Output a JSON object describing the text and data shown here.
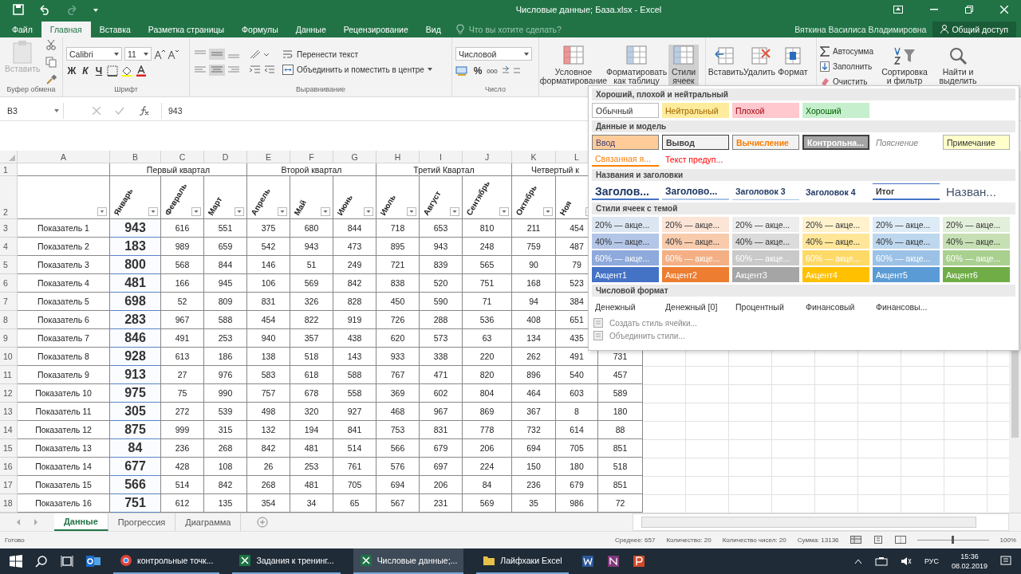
{
  "title_bar": {
    "title": "Числовые данные; База.xlsx - Excel"
  },
  "ribbon_tabs": [
    {
      "label": "Файл",
      "selected": false
    },
    {
      "label": "Главная",
      "selected": true
    },
    {
      "label": "Вставка",
      "selected": false
    },
    {
      "label": "Разметка страницы",
      "selected": false
    },
    {
      "label": "Формулы",
      "selected": false
    },
    {
      "label": "Данные",
      "selected": false
    },
    {
      "label": "Рецензирование",
      "selected": false
    },
    {
      "label": "Вид",
      "selected": false
    }
  ],
  "tell_me": {
    "placeholder": "Что вы хотите сделать?"
  },
  "user": "Вяткина Василиса Владимировна",
  "share": "Общий доступ",
  "ribbon": {
    "clipboard": {
      "paste": "Вставить",
      "label": "Буфер обмена"
    },
    "font": {
      "name": "Calibri",
      "size": "11",
      "bold": "Ж",
      "italic": "К",
      "underline": "Ч",
      "label": "Шрифт"
    },
    "alignment": {
      "wrap": "Перенести текст",
      "merge": "Объединить и поместить в центре",
      "label": "Выравнивание"
    },
    "number": {
      "format": "Числовой",
      "percent": "%",
      "thousands": "000",
      "label": "Число"
    },
    "styles": [
      {
        "label": "Условное форматирование",
        "selected": false
      },
      {
        "label": "Форматировать как таблицу",
        "selected": false
      },
      {
        "label": "Стили ячеек",
        "selected": true
      }
    ],
    "cells": [
      "Вставить",
      "Удалить",
      "Формат"
    ],
    "editing": {
      "autosum": "Автосумма",
      "fill": "Заполнить",
      "clear": "Очистить",
      "sort": "Сортировка и фильтр",
      "find": "Найти и выделить"
    }
  },
  "formula_bar": {
    "name_box": "B3",
    "value": "943"
  },
  "sheet": {
    "columns": [
      "A",
      "B",
      "C",
      "D",
      "E",
      "F",
      "G",
      "H",
      "I",
      "J",
      "K",
      "L"
    ],
    "quarters": [
      "Первый квартал",
      "Второй квартал",
      "Третий Квартал",
      "Четвертый к"
    ],
    "header_rows": [
      "1",
      "2"
    ],
    "months": [
      "Январь",
      "Февраль",
      "Март",
      "Апрель",
      "Май",
      "Июнь",
      "Июль",
      "Август",
      "Сентябрь",
      "Октябрь",
      "Ноя"
    ],
    "rows": [
      {
        "num": "3",
        "label": "Показатель 1",
        "values": [
          "943",
          "616",
          "551",
          "375",
          "680",
          "844",
          "718",
          "653",
          "810",
          "211",
          "454"
        ]
      },
      {
        "num": "4",
        "label": "Показатель 2",
        "values": [
          "183",
          "989",
          "659",
          "542",
          "943",
          "473",
          "895",
          "943",
          "248",
          "759",
          "487"
        ]
      },
      {
        "num": "5",
        "label": "Показатель 3",
        "values": [
          "800",
          "568",
          "844",
          "146",
          "51",
          "249",
          "721",
          "839",
          "565",
          "90",
          "79"
        ]
      },
      {
        "num": "6",
        "label": "Показатель 4",
        "values": [
          "481",
          "166",
          "945",
          "106",
          "569",
          "842",
          "838",
          "520",
          "751",
          "168",
          "523"
        ]
      },
      {
        "num": "7",
        "label": "Показатель 5",
        "values": [
          "698",
          "52",
          "809",
          "831",
          "326",
          "828",
          "450",
          "590",
          "71",
          "94",
          "384"
        ]
      },
      {
        "num": "8",
        "label": "Показатель 6",
        "values": [
          "283",
          "967",
          "588",
          "454",
          "822",
          "919",
          "726",
          "288",
          "536",
          "408",
          "651"
        ]
      },
      {
        "num": "9",
        "label": "Показатель 7",
        "values": [
          "846",
          "491",
          "253",
          "940",
          "357",
          "438",
          "620",
          "573",
          "63",
          "134",
          "435"
        ]
      },
      {
        "num": "10",
        "label": "Показатель 8",
        "values": [
          "928",
          "613",
          "186",
          "138",
          "518",
          "143",
          "933",
          "338",
          "220",
          "262",
          "491",
          "731"
        ]
      },
      {
        "num": "11",
        "label": "Показатель 9",
        "values": [
          "913",
          "27",
          "976",
          "583",
          "618",
          "588",
          "767",
          "471",
          "820",
          "896",
          "540",
          "457"
        ]
      },
      {
        "num": "12",
        "label": "Показатель 10",
        "values": [
          "975",
          "75",
          "990",
          "757",
          "678",
          "558",
          "369",
          "602",
          "804",
          "464",
          "603",
          "589"
        ]
      },
      {
        "num": "13",
        "label": "Показатель 11",
        "values": [
          "305",
          "272",
          "539",
          "498",
          "320",
          "927",
          "468",
          "967",
          "869",
          "367",
          "8",
          "180"
        ]
      },
      {
        "num": "14",
        "label": "Показатель 12",
        "values": [
          "875",
          "999",
          "315",
          "132",
          "194",
          "841",
          "753",
          "831",
          "778",
          "732",
          "614",
          "88"
        ]
      },
      {
        "num": "15",
        "label": "Показатель 13",
        "values": [
          "84",
          "236",
          "268",
          "842",
          "481",
          "514",
          "566",
          "679",
          "206",
          "694",
          "705",
          "851"
        ]
      },
      {
        "num": "16",
        "label": "Показатель 14",
        "values": [
          "677",
          "428",
          "108",
          "26",
          "253",
          "761",
          "576",
          "697",
          "224",
          "150",
          "180",
          "518"
        ]
      },
      {
        "num": "17",
        "label": "Показатель 15",
        "values": [
          "566",
          "514",
          "842",
          "268",
          "481",
          "705",
          "694",
          "206",
          "84",
          "236",
          "679",
          "851"
        ]
      },
      {
        "num": "18",
        "label": "Показатель 16",
        "values": [
          "751",
          "612",
          "135",
          "354",
          "34",
          "65",
          "567",
          "231",
          "569",
          "35",
          "986",
          "72"
        ]
      }
    ]
  },
  "cell_styles_menu": {
    "sections": [
      {
        "title": "Хороший, плохой и нейтральный",
        "items": [
          {
            "label": "Обычный",
            "kind": "normal"
          },
          {
            "label": "Нейтральный",
            "kind": "neutral"
          },
          {
            "label": "Плохой",
            "kind": "bad"
          },
          {
            "label": "Хороший",
            "kind": "good"
          }
        ]
      },
      {
        "title": "Данные и модель",
        "items": [
          {
            "label": "Ввод",
            "kind": "input"
          },
          {
            "label": "Вывод",
            "kind": "output"
          },
          {
            "label": "Вычисление",
            "kind": "calc"
          },
          {
            "label": "Контрольна...",
            "kind": "check"
          },
          {
            "label": "Пояснение",
            "kind": "explain"
          },
          {
            "label": "Примечание",
            "kind": "note"
          },
          {
            "label": "Связанная я...",
            "kind": "linked"
          },
          {
            "label": "Текст предуп...",
            "kind": "warning"
          }
        ]
      },
      {
        "title": "Названия и заголовки",
        "items": [
          {
            "label": "Заголов...",
            "kind": "h1"
          },
          {
            "label": "Заголово...",
            "kind": "h2"
          },
          {
            "label": "Заголовок 3",
            "kind": "h3"
          },
          {
            "label": "Заголовок 4",
            "kind": "h4"
          },
          {
            "label": "Итог",
            "kind": "total"
          },
          {
            "label": "Назван...",
            "kind": "title"
          }
        ]
      },
      {
        "title": "Стили ячеек с темой",
        "items": [
          {
            "label": "20% — акце...",
            "kind": "light",
            "color": "#dce6f2"
          },
          {
            "label": "20% — акце...",
            "kind": "light",
            "color": "#fce4d6"
          },
          {
            "label": "20% — акце...",
            "kind": "light",
            "color": "#ededed"
          },
          {
            "label": "20% — акце...",
            "kind": "light",
            "color": "#fff2cc"
          },
          {
            "label": "20% — акце...",
            "kind": "light",
            "color": "#ddebf7"
          },
          {
            "label": "20% — акце...",
            "kind": "light",
            "color": "#e2efda"
          },
          {
            "label": "40% — акце...",
            "kind": "light",
            "color": "#b4c6e7"
          },
          {
            "label": "40% — акце...",
            "kind": "light",
            "color": "#f8cbad"
          },
          {
            "label": "40% — акце...",
            "kind": "light",
            "color": "#dbdbdb"
          },
          {
            "label": "40% — акце...",
            "kind": "light",
            "color": "#ffe699"
          },
          {
            "label": "40% — акце...",
            "kind": "light",
            "color": "#bdd7ee"
          },
          {
            "label": "40% — акце...",
            "kind": "light",
            "color": "#c6e0b4"
          },
          {
            "label": "60% — акце...",
            "kind": "dark",
            "color": "#8ea9db"
          },
          {
            "label": "60% — акце...",
            "kind": "dark",
            "color": "#f4b084"
          },
          {
            "label": "60% — акце...",
            "kind": "dark",
            "color": "#c9c9c9"
          },
          {
            "label": "60% — акце...",
            "kind": "dark",
            "color": "#ffd966"
          },
          {
            "label": "60% — акце...",
            "kind": "dark",
            "color": "#9bc2e6"
          },
          {
            "label": "60% — акце...",
            "kind": "dark",
            "color": "#a9d08e"
          },
          {
            "label": "Акцент1",
            "kind": "dark",
            "color": "#4472c4"
          },
          {
            "label": "Акцент2",
            "kind": "dark",
            "color": "#ed7d31"
          },
          {
            "label": "Акцент3",
            "kind": "dark",
            "color": "#a5a5a5"
          },
          {
            "label": "Акцент4",
            "kind": "dark",
            "color": "#ffc000"
          },
          {
            "label": "Акцент5",
            "kind": "dark",
            "color": "#5b9bd5"
          },
          {
            "label": "Акцент6",
            "kind": "dark",
            "color": "#70ad47"
          }
        ]
      },
      {
        "title": "Числовой формат",
        "items": [
          {
            "label": "Денежный",
            "kind": "plain"
          },
          {
            "label": "Денежный [0]",
            "kind": "plain"
          },
          {
            "label": "Процентный",
            "kind": "plain"
          },
          {
            "label": "Финансовый",
            "kind": "plain"
          },
          {
            "label": "Финансовы...",
            "kind": "plain"
          }
        ]
      }
    ],
    "actions": [
      "Создать стиль ячейки...",
      "Объединить стили..."
    ]
  },
  "sheet_tabs": [
    {
      "label": "Данные",
      "selected": true
    },
    {
      "label": "Прогрессия",
      "selected": false
    },
    {
      "label": "Диаграмма",
      "selected": false
    }
  ],
  "status_bar": {
    "state": "Готово",
    "stats": [
      "Среднее: 657",
      "Количество: 20",
      "Количество чисел: 20",
      "Сумма: 13136"
    ],
    "zoom": "100%",
    "level": 0.5
  },
  "taskbar": {
    "apps": [
      {
        "label": "контрольные точк...",
        "selected": false
      },
      {
        "label": "Задания к тренинг...",
        "selected": false
      },
      {
        "label": "Числовые данные;...",
        "selected": true
      },
      {
        "label": "Лайфхаки Excel",
        "selected": false
      }
    ],
    "language": "РУС",
    "time": "15:36",
    "date": "08.02.2019"
  }
}
